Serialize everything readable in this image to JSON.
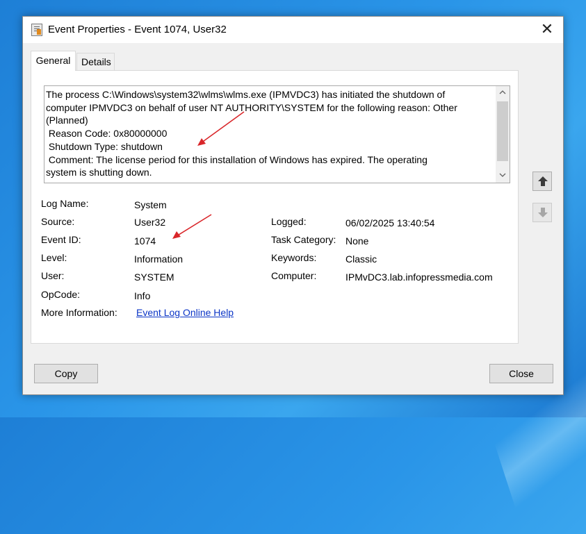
{
  "window": {
    "title": "Event Properties - Event 1074, User32",
    "close_glyph": "✕"
  },
  "tabs": [
    {
      "label": "General",
      "active": true
    },
    {
      "label": "Details",
      "active": false
    }
  ],
  "description": "The process C:\\Windows\\system32\\wlms\\wlms.exe (IPMVDC3) has initiated the shutdown of\ncomputer IPMVDC3 on behalf of user NT AUTHORITY\\SYSTEM for the following reason: Other\n(Planned)\n Reason Code: 0x80000000\n Shutdown Type: shutdown\n Comment: The license period for this installation of Windows has expired. The operating\nsystem is shutting down.",
  "fields": {
    "log_name": {
      "label": "Log Name:",
      "value": "System"
    },
    "source": {
      "label": "Source:",
      "value": "User32"
    },
    "event_id": {
      "label": "Event ID:",
      "value": "1074"
    },
    "level": {
      "label": "Level:",
      "value": "Information"
    },
    "user": {
      "label": "User:",
      "value": "SYSTEM"
    },
    "opcode": {
      "label": "OpCode:",
      "value": "Info"
    },
    "more_information": {
      "label": "More Information:",
      "link": "Event Log Online Help"
    },
    "logged": {
      "label": "Logged:",
      "value": "06/02/2025 13:40:54"
    },
    "task_category": {
      "label": "Task Category:",
      "value": "None"
    },
    "keywords": {
      "label": "Keywords:",
      "value": "Classic"
    },
    "computer": {
      "label": "Computer:",
      "value": "IPMvDC3.lab.infopressmedia.com"
    }
  },
  "buttons": {
    "copy": "Copy",
    "close": "Close"
  },
  "icons": {
    "app": "event-viewer-icon",
    "close": "close-icon",
    "previous": "up-arrow-icon",
    "next": "down-arrow-icon",
    "scroll_up": "chevron-up-icon",
    "scroll_down": "chevron-down-icon"
  },
  "colors": {
    "desktop": "#1e7fd6",
    "link": "#0b35c6",
    "annotation_arrow": "#d9262a"
  }
}
